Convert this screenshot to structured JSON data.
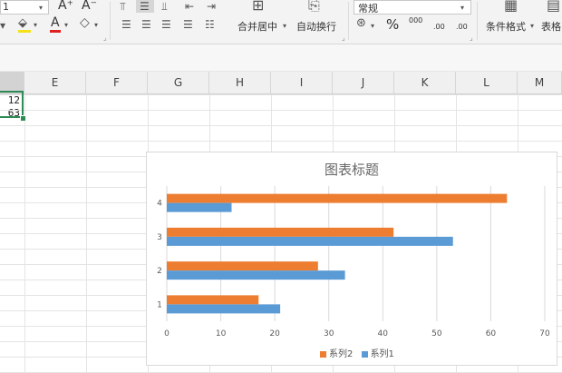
{
  "ribbon": {
    "font_size_value": "1",
    "font_grow_icon": "A⁺",
    "font_shrink_icon": "A⁻",
    "fill_color": "#f5e11a",
    "font_color": "#e02020",
    "merge_center_label": "合并居中",
    "wrap_text_label": "自动换行",
    "number_format_value": "常规",
    "percent_symbol": "%",
    "thousands_label": "000",
    "increase_decimal_label": ".00",
    "decrease_decimal_label": ".00",
    "conditional_format_label": "条件格式",
    "table_style_label": "表格"
  },
  "grid": {
    "column_headers": [
      "E",
      "F",
      "G",
      "H",
      "I",
      "J",
      "K",
      "L",
      "M"
    ],
    "cells": [
      "12",
      "63"
    ],
    "accent": "#2e8b57"
  },
  "chart_data": {
    "type": "bar",
    "orientation": "horizontal",
    "title": "图表标题",
    "categories": [
      "1",
      "2",
      "3",
      "4"
    ],
    "series": [
      {
        "name": "系列1",
        "color": "#5b9bd5",
        "values": [
          21,
          33,
          53,
          12
        ]
      },
      {
        "name": "系列2",
        "color": "#ed7d31",
        "values": [
          17,
          28,
          42,
          63
        ]
      }
    ],
    "xlim": [
      0,
      70
    ],
    "xticks": [
      "0",
      "10",
      "20",
      "30",
      "40",
      "50",
      "60",
      "70"
    ],
    "grid": true,
    "legend_position": "bottom"
  }
}
